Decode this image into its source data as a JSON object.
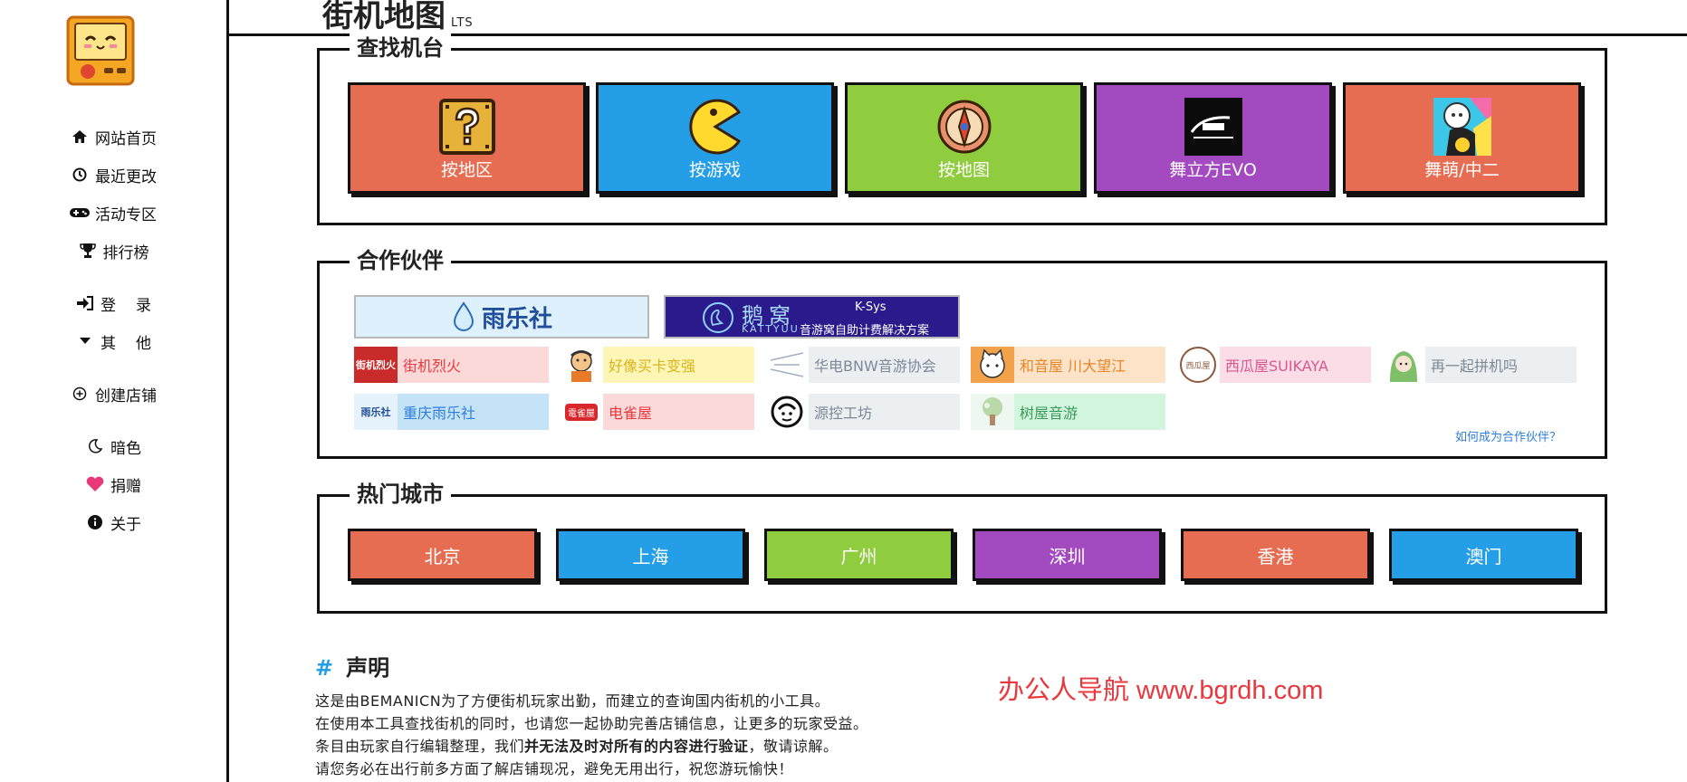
{
  "sidebar": {
    "items": [
      {
        "label": "网站首页",
        "icon": "home-icon"
      },
      {
        "label": "最近更改",
        "icon": "clock-icon"
      },
      {
        "label": "活动专区",
        "icon": "gamepad-icon"
      },
      {
        "label": "排行榜",
        "icon": "trophy-icon"
      },
      {
        "label": "登录",
        "icon": "login-icon"
      },
      {
        "label": "其他",
        "icon": "caret-down-icon"
      },
      {
        "label": "创建店铺",
        "icon": "plus-circle-icon"
      },
      {
        "label": "暗色",
        "icon": "moon-icon"
      },
      {
        "label": "捐赠",
        "icon": "heart-icon"
      },
      {
        "label": "关于",
        "icon": "info-icon"
      }
    ]
  },
  "header": {
    "title": "街机地图",
    "badge": "LTS"
  },
  "find": {
    "legend": "查找机台",
    "tiles": [
      {
        "label": "按地区",
        "color": "#e76d52",
        "icon": "question-block-icon"
      },
      {
        "label": "按游戏",
        "color": "#259ee8",
        "icon": "pacman-icon"
      },
      {
        "label": "按地图",
        "color": "#8fcd3f",
        "icon": "compass-icon"
      },
      {
        "label": "舞立方EVO",
        "color": "#a34ac0",
        "icon": "dance-cube-logo"
      },
      {
        "label": "舞萌/中二",
        "color": "#e76d52",
        "icon": "maimai-icon"
      }
    ]
  },
  "partners": {
    "legend": "合作伙伴",
    "banners": [
      {
        "name": "雨乐社"
      },
      {
        "name": "鹅窝",
        "sub": "KATTYUU",
        "tag": "K-Sys",
        "desc": "音游窝自助计费解决方案"
      }
    ],
    "items": [
      {
        "name": "街机烈火",
        "bg": "#fcd9d9",
        "color": "#e8383d",
        "logo_text": "街机烈火"
      },
      {
        "name": "好像买卡变强",
        "bg": "#fdf6b6",
        "color": "#d9b41c"
      },
      {
        "name": "华电BNW音游协会",
        "bg": "#eceff2",
        "color": "#7d8894"
      },
      {
        "name": "和音屋 川大望江",
        "bg": "#fde3c7",
        "color": "#e8842a"
      },
      {
        "name": "西瓜屋SUIKAYA",
        "bg": "#fbdde8",
        "color": "#d8588c",
        "logo_text": "西瓜屋"
      },
      {
        "name": "再一起拼机吗",
        "bg": "#eceff2",
        "color": "#7d8894"
      },
      {
        "name": "重庆雨乐社",
        "bg": "#c5e3f6",
        "color": "#2d7ddb",
        "logo_text": "雨乐社"
      },
      {
        "name": "电雀屋",
        "bg": "#fcd9d9",
        "color": "#e8383d",
        "logo_text": "電雀屋"
      },
      {
        "name": "源控工坊",
        "bg": "#eceff2",
        "color": "#7d8894"
      },
      {
        "name": "树屋音游",
        "bg": "#d2f5de",
        "color": "#3a9a5a"
      }
    ],
    "howto": "如何成为合作伙伴？"
  },
  "cities": {
    "legend": "热门城市",
    "items": [
      {
        "label": "北京",
        "color": "#e76d52"
      },
      {
        "label": "上海",
        "color": "#259ee8"
      },
      {
        "label": "广州",
        "color": "#8fcd3f"
      },
      {
        "label": "深圳",
        "color": "#a34ac0"
      },
      {
        "label": "香港",
        "color": "#e76d52"
      },
      {
        "label": "澳门",
        "color": "#259ee8"
      }
    ]
  },
  "statement": {
    "heading": "声明",
    "line1": "这是由BEMANICN为了方便街机玩家出勤，而建立的查询国内街机的小工具。",
    "line2": "在使用本工具查找街机的同时，也请您一起协助完善店铺信息，让更多的玩家受益。",
    "line3_a": "条目由玩家自行编辑整理，我们",
    "line3_b": "并无法及时对所有的内容进行验证",
    "line3_c": "，敬请谅解。",
    "line4": "请您务必在出行前多方面了解店铺现况，避免无用出行，祝您游玩愉快！"
  },
  "watermark": "办公人导航  www.bgrdh.com"
}
